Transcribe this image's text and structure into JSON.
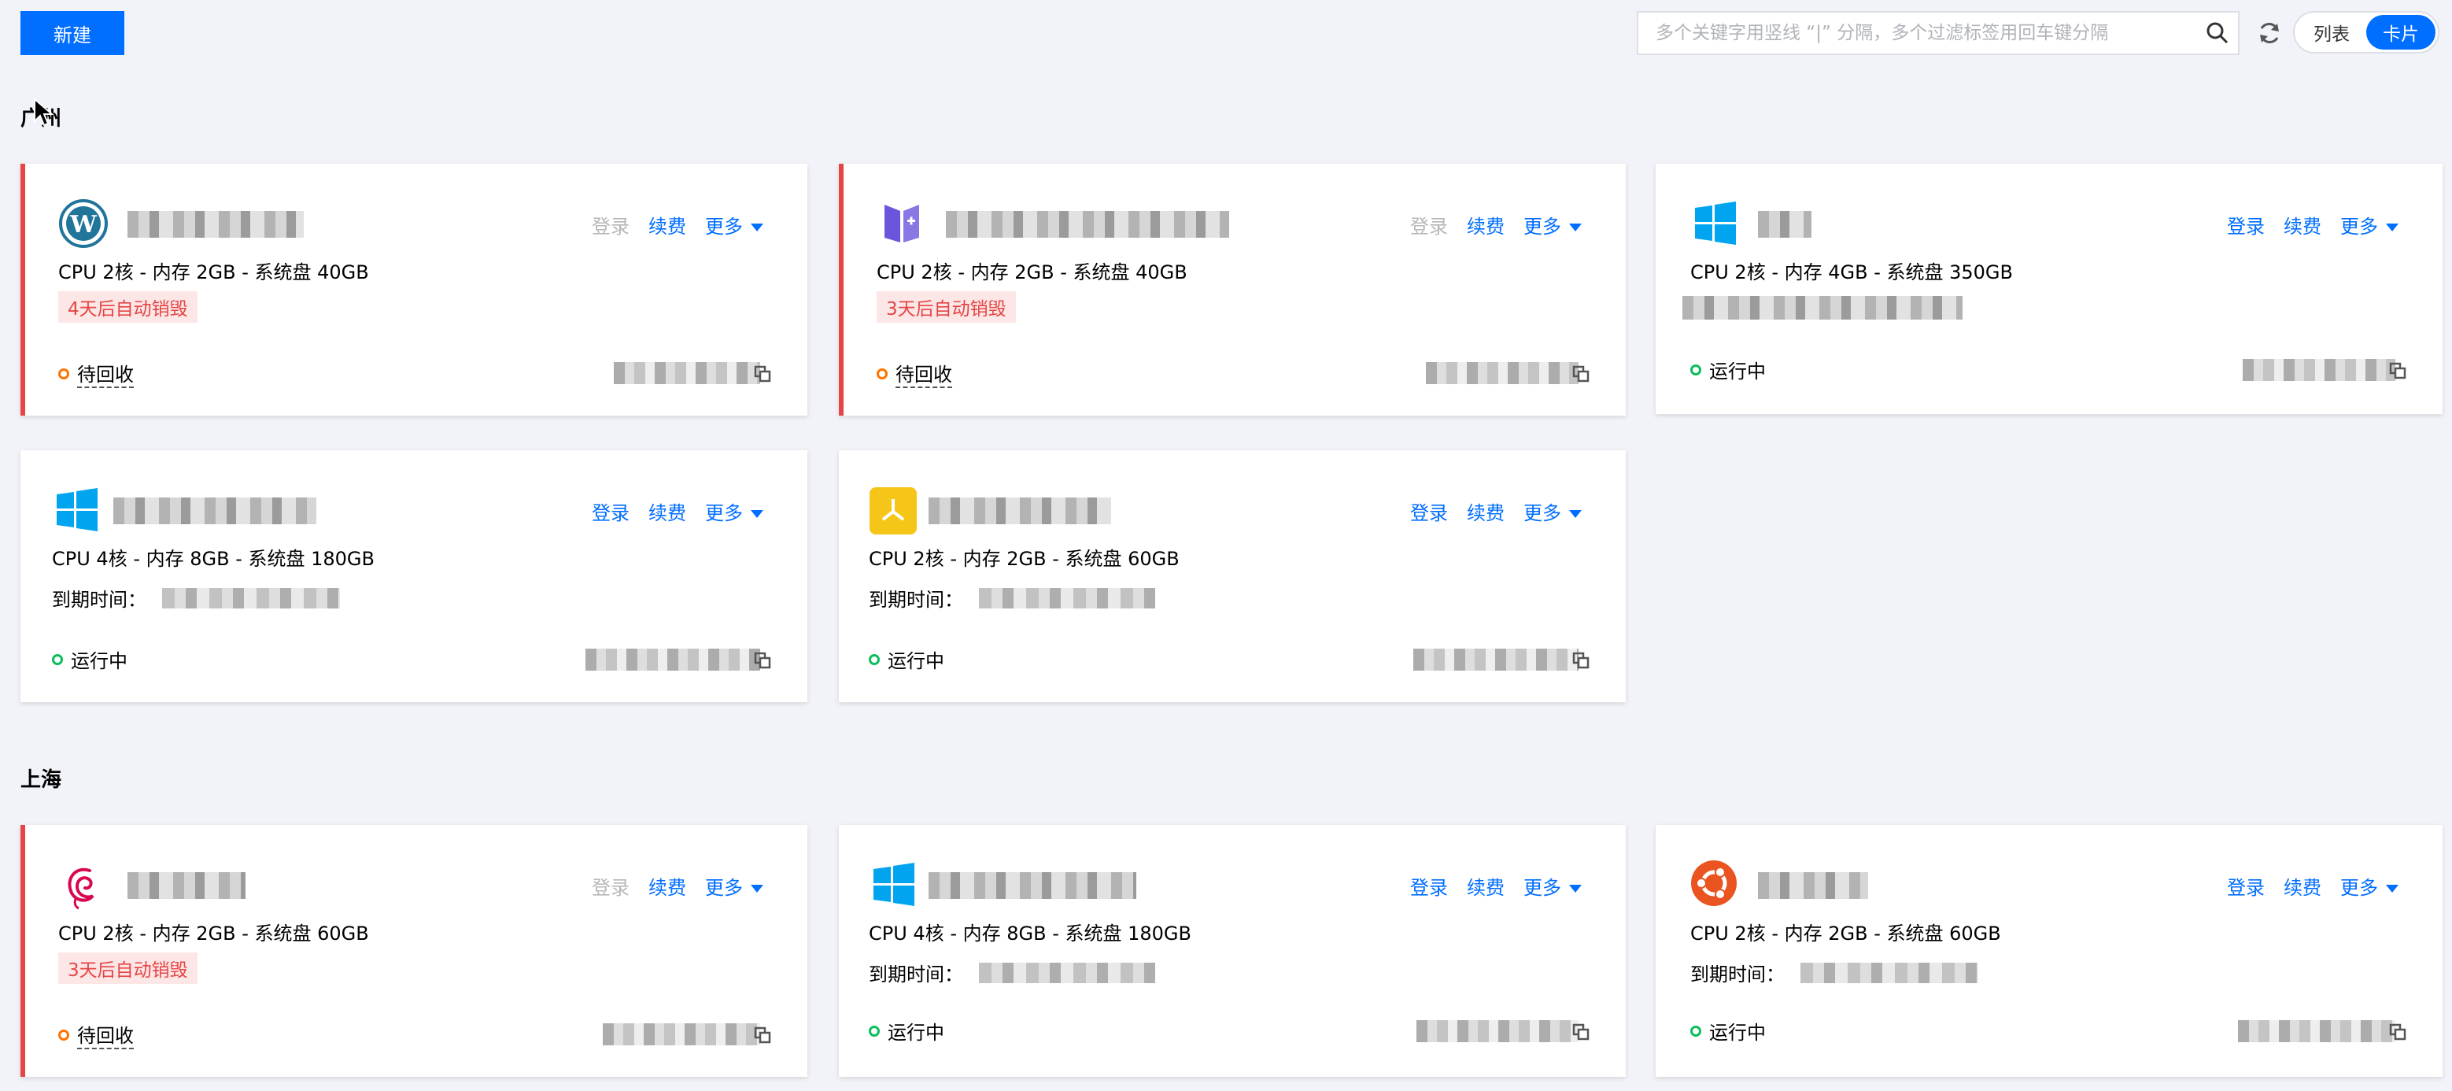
{
  "toolbar": {
    "new_label": "新建",
    "search_placeholder": "多个关键字用竖线 “|” 分隔，多个过滤标签用回车键分隔",
    "view_list": "列表",
    "view_card": "卡片"
  },
  "regions": [
    {
      "title": "广州",
      "cards": [
        {
          "os": "wordpress-icon",
          "spec": "CPU 2核 - 内存 2GB - 系统盘 40GB",
          "badge": "4天后自动销毁",
          "status": "待回收",
          "status_color": "orange",
          "login_enabled": false
        },
        {
          "os": "lighthouse-icon",
          "spec": "CPU 2核 - 内存 2GB - 系统盘 40GB",
          "badge": "3天后自动销毁",
          "status": "待回收",
          "status_color": "orange",
          "login_enabled": false
        },
        {
          "os": "windows-icon",
          "spec": "CPU 2核 - 内存 4GB - 系统盘 350GB",
          "status": "运行中",
          "status_color": "green",
          "login_enabled": true
        },
        {
          "os": "windows-icon",
          "spec": "CPU 4核 - 内存 8GB - 系统盘 180GB",
          "expiry_label": "到期时间：",
          "status": "运行中",
          "status_color": "green",
          "login_enabled": true
        },
        {
          "os": "app-icon",
          "spec": "CPU 2核 - 内存 2GB - 系统盘 60GB",
          "expiry_label": "到期时间：",
          "status": "运行中",
          "status_color": "green",
          "login_enabled": true
        }
      ]
    },
    {
      "title": "上海",
      "cards": [
        {
          "os": "debian-icon",
          "spec": "CPU 2核 - 内存 2GB - 系统盘 60GB",
          "badge": "3天后自动销毁",
          "status": "待回收",
          "status_color": "orange",
          "login_enabled": false
        },
        {
          "os": "windows-icon",
          "spec": "CPU 4核 - 内存 8GB - 系统盘 180GB",
          "expiry_label": "到期时间：",
          "status": "运行中",
          "status_color": "green",
          "login_enabled": true
        },
        {
          "os": "ubuntu-icon",
          "spec": "CPU 2核 - 内存 2GB - 系统盘 60GB",
          "expiry_label": "到期时间：",
          "status": "运行中",
          "status_color": "green",
          "login_enabled": true
        }
      ]
    }
  ],
  "actions": {
    "login": "登录",
    "renew": "续费",
    "more": "更多"
  },
  "colors": {
    "accent": "#006eff",
    "danger": "#e54545",
    "warning": "#ff7200",
    "success": "#0abf5b",
    "background": "#f2f3f8"
  }
}
